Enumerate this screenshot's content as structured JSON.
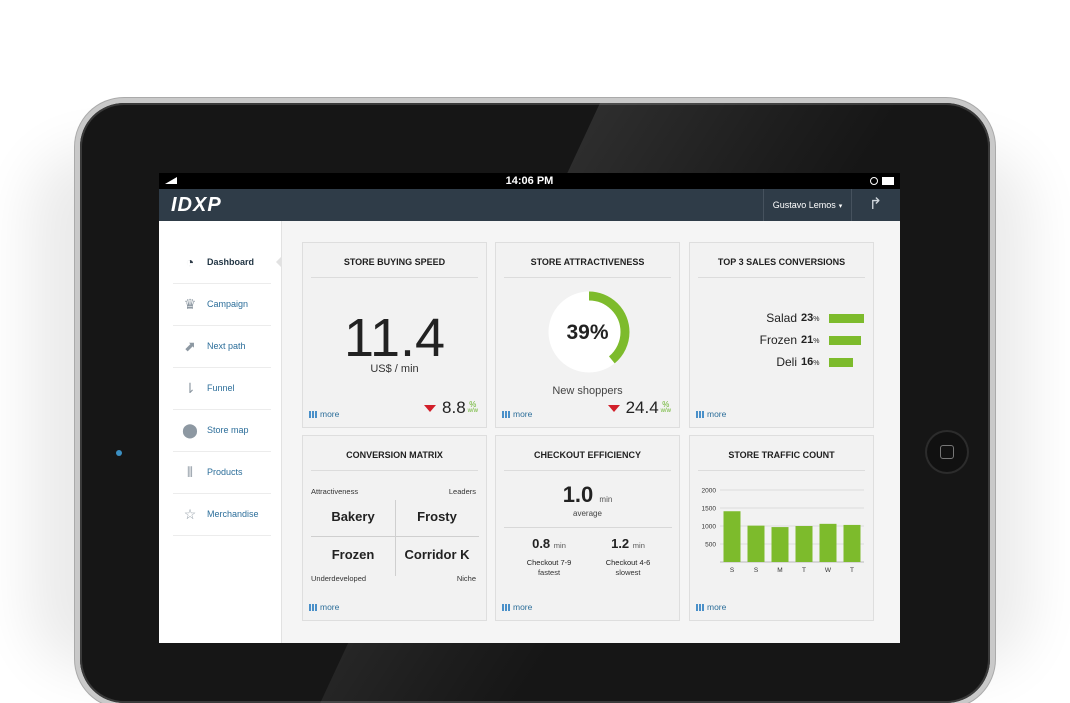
{
  "statusbar": {
    "time": "14:06 PM"
  },
  "navbar": {
    "logo": "IDXP",
    "user": "Gustavo Lemos",
    "user_caret": "▾",
    "share_icon": "↱"
  },
  "sidebar": {
    "items": [
      {
        "label": "Dashboard",
        "icon": "gauge-icon",
        "glyph": "◔",
        "active": true
      },
      {
        "label": "Campaign",
        "icon": "trophy-icon",
        "glyph": "♛"
      },
      {
        "label": "Next path",
        "icon": "path-icon",
        "glyph": "⬈"
      },
      {
        "label": "Funnel",
        "icon": "funnel-icon",
        "glyph": "⇂"
      },
      {
        "label": "Store map",
        "icon": "map-pin-icon",
        "glyph": "⬤"
      },
      {
        "label": "Products",
        "icon": "barcode-icon",
        "glyph": "⦀"
      },
      {
        "label": "Merchandise",
        "icon": "star-icon",
        "glyph": "☆"
      }
    ]
  },
  "cards": {
    "buying_speed": {
      "title": "STORE BUYING SPEED",
      "value": "11.4",
      "unit": "US$ / min",
      "change": "8.8",
      "change_unit_top": "%",
      "change_unit_bottom": "w/w",
      "more": "more"
    },
    "attractiveness": {
      "title": "STORE ATTRACTIVENESS",
      "percent_label": "39%",
      "percent": 0.39,
      "subtitle": "New shoppers",
      "change": "24.4",
      "change_unit_top": "%",
      "change_unit_bottom": "w/w",
      "more": "more"
    },
    "top_sales": {
      "title": "TOP 3 SALES CONVERSIONS",
      "rows": [
        {
          "name": "Salad",
          "value": "23",
          "unit": "%",
          "pct": 23
        },
        {
          "name": "Frozen",
          "value": "21",
          "unit": "%",
          "pct": 21
        },
        {
          "name": "Deli",
          "value": "16",
          "unit": "%",
          "pct": 16
        }
      ],
      "more": "more"
    },
    "matrix": {
      "title": "CONVERSION MATRIX",
      "top_left_label": "Attractiveness",
      "top_right_label": "Leaders",
      "bottom_left_label": "Underdeveloped",
      "bottom_right_label": "Niche",
      "cells": [
        "Bakery",
        "Frosty",
        "Frozen",
        "Corridor K"
      ],
      "more": "more"
    },
    "checkout": {
      "title": "CHECKOUT EFFICIENCY",
      "average_value": "1.0",
      "average_unit": "min",
      "average_label": "average",
      "fastest": {
        "value": "0.8",
        "unit": "min",
        "name": "Checkout 7-9",
        "label": "fastest"
      },
      "slowest": {
        "value": "1.2",
        "unit": "min",
        "name": "Checkout 4-6",
        "label": "slowest"
      },
      "more": "more"
    },
    "traffic": {
      "title": "STORE TRAFFIC COUNT",
      "more": "more"
    }
  },
  "chart_data": {
    "type": "bar",
    "categories": [
      "S",
      "S",
      "M",
      "T",
      "W",
      "T"
    ],
    "values": [
      1410,
      1010,
      970,
      1000,
      1060,
      1030
    ],
    "ylim": [
      0,
      2000
    ],
    "yticks": [
      500,
      1000,
      1500,
      2000
    ],
    "grid": true,
    "bar_color": "#7dbb2c"
  },
  "colors": {
    "accent_green": "#7dbb2c",
    "navbar": "#2f3c48",
    "down_red": "#d21f2a",
    "link_blue": "#2c6e9a"
  }
}
